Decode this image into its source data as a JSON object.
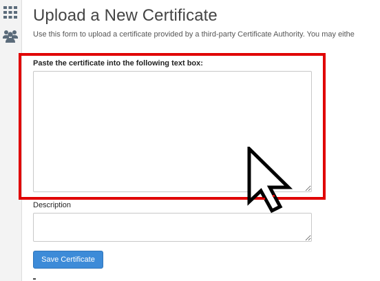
{
  "sidebar": {
    "icons": [
      "grid-icon",
      "users-icon"
    ]
  },
  "page": {
    "title": "Upload a New Certificate",
    "intro": "Use this form to upload a certificate provided by a third-party Certificate Authority. You may eithe"
  },
  "form": {
    "certificate_label": "Paste the certificate into the following text box:",
    "certificate_value": "",
    "description_label": "Description",
    "description_value": "",
    "save_label": "Save Certificate"
  },
  "colors": {
    "highlight": "#e00000",
    "primary_button": "#3d8bd8",
    "sidebar_icon": "#5b6b7a"
  },
  "cursor_icon": "arrow-cursor-icon"
}
